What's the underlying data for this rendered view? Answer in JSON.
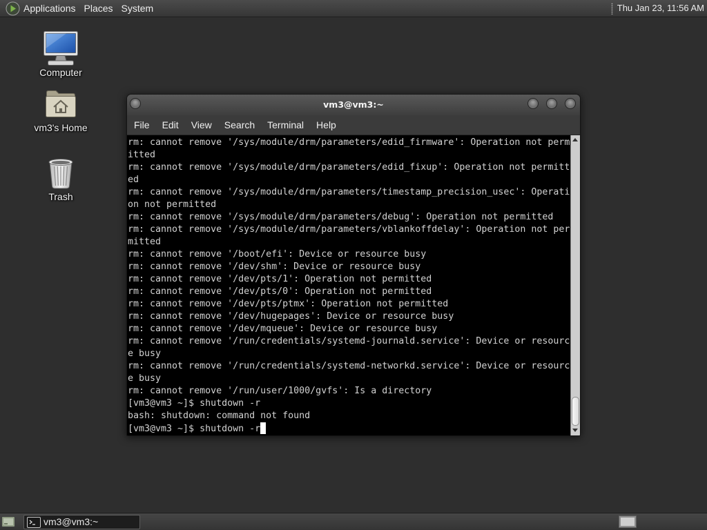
{
  "top_panel": {
    "logo_icon": "applications-menu-logo-icon",
    "menus": [
      "Applications",
      "Places",
      "System"
    ],
    "clock": "Thu Jan 23, 11:56 AM"
  },
  "desktop": {
    "icons": [
      {
        "label": "Computer",
        "icon": "computer-icon"
      },
      {
        "label": "vm3's Home",
        "icon": "home-folder-icon"
      },
      {
        "label": "Trash",
        "icon": "trash-icon"
      }
    ]
  },
  "terminal": {
    "title": "vm3@vm3:~",
    "menu": [
      "File",
      "Edit",
      "View",
      "Search",
      "Terminal",
      "Help"
    ],
    "lines": [
      "rm: cannot remove '/sys/module/drm/parameters/edid_firmware': Operation not perm",
      "itted",
      "rm: cannot remove '/sys/module/drm/parameters/edid_fixup': Operation not permitt",
      "ed",
      "rm: cannot remove '/sys/module/drm/parameters/timestamp_precision_usec': Operati",
      "on not permitted",
      "rm: cannot remove '/sys/module/drm/parameters/debug': Operation not permitted",
      "rm: cannot remove '/sys/module/drm/parameters/vblankoffdelay': Operation not per",
      "mitted",
      "rm: cannot remove '/boot/efi': Device or resource busy",
      "rm: cannot remove '/dev/shm': Device or resource busy",
      "rm: cannot remove '/dev/pts/1': Operation not permitted",
      "rm: cannot remove '/dev/pts/0': Operation not permitted",
      "rm: cannot remove '/dev/pts/ptmx': Operation not permitted",
      "rm: cannot remove '/dev/hugepages': Device or resource busy",
      "rm: cannot remove '/dev/mqueue': Device or resource busy",
      "rm: cannot remove '/run/credentials/systemd-journald.service': Device or resourc",
      "e busy",
      "rm: cannot remove '/run/credentials/systemd-networkd.service': Device or resourc",
      "e busy",
      "rm: cannot remove '/run/user/1000/gvfs': Is a directory",
      "[vm3@vm3 ~]$ shutdown -r",
      "bash: shutdown: command not found"
    ],
    "prompt": "[vm3@vm3 ~]$",
    "input": "shutdown -r",
    "scrollbar": {
      "position": 1.0
    }
  },
  "bottom_panel": {
    "show_desktop_icon": "show-desktop-icon",
    "tasks": [
      {
        "label": "vm3@vm3:~",
        "icon": "terminal-icon"
      }
    ],
    "workspace_switcher_icon": "workspace-switcher-icon"
  },
  "colors": {
    "desktop_bg": "#2e2e2e",
    "terminal_bg": "#000000",
    "terminal_fg": "#d2d2d2",
    "cursor": "#ffffff",
    "panel_text": "#ececec"
  }
}
